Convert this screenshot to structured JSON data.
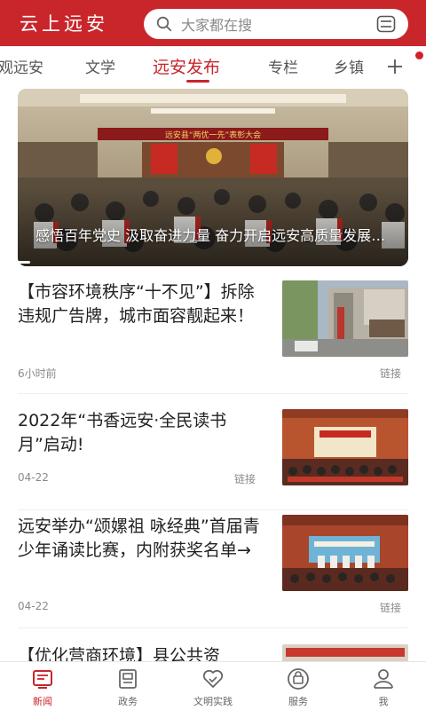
{
  "header": {
    "app_title": "云上远安",
    "search_placeholder": "大家都在搜",
    "brand_color": "#c8262b"
  },
  "tabs": {
    "items": [
      {
        "label": "观远安",
        "active": false
      },
      {
        "label": "文学",
        "active": false
      },
      {
        "label": "远安发布",
        "active": true
      },
      {
        "label": "专栏",
        "active": false
      },
      {
        "label": "乡镇",
        "active": false
      }
    ],
    "more_icon": "plus-icon"
  },
  "hero": {
    "banner_text": "远安县“两优一先”表彰大会",
    "caption": "感悟百年党史 汲取奋进力量 奋力开启远安高质量发展新征程"
  },
  "news": [
    {
      "title": "【市容环境秩序“十不见”】拆除违规广告牌，城市面容靓起来！",
      "time": "6小时前",
      "tag": "链接"
    },
    {
      "title": "2022年“书香远安·全民读书月”启动!",
      "time": "04-22",
      "tag": "链接"
    },
    {
      "title": "远安举办“颂嫘祖 咏经典”首届青少年诵读比赛，内附获奖名单→",
      "time": "04-22",
      "tag": "链接"
    },
    {
      "title": "【优化营商环境】县公共资"
    }
  ],
  "bottom_nav": [
    {
      "label": "新闻",
      "icon": "news-icon",
      "active": true
    },
    {
      "label": "政务",
      "icon": "gov-icon",
      "active": false
    },
    {
      "label": "文明实践",
      "icon": "heart-icon",
      "active": false
    },
    {
      "label": "服务",
      "icon": "service-icon",
      "active": false
    },
    {
      "label": "我",
      "icon": "user-icon",
      "active": false
    }
  ]
}
